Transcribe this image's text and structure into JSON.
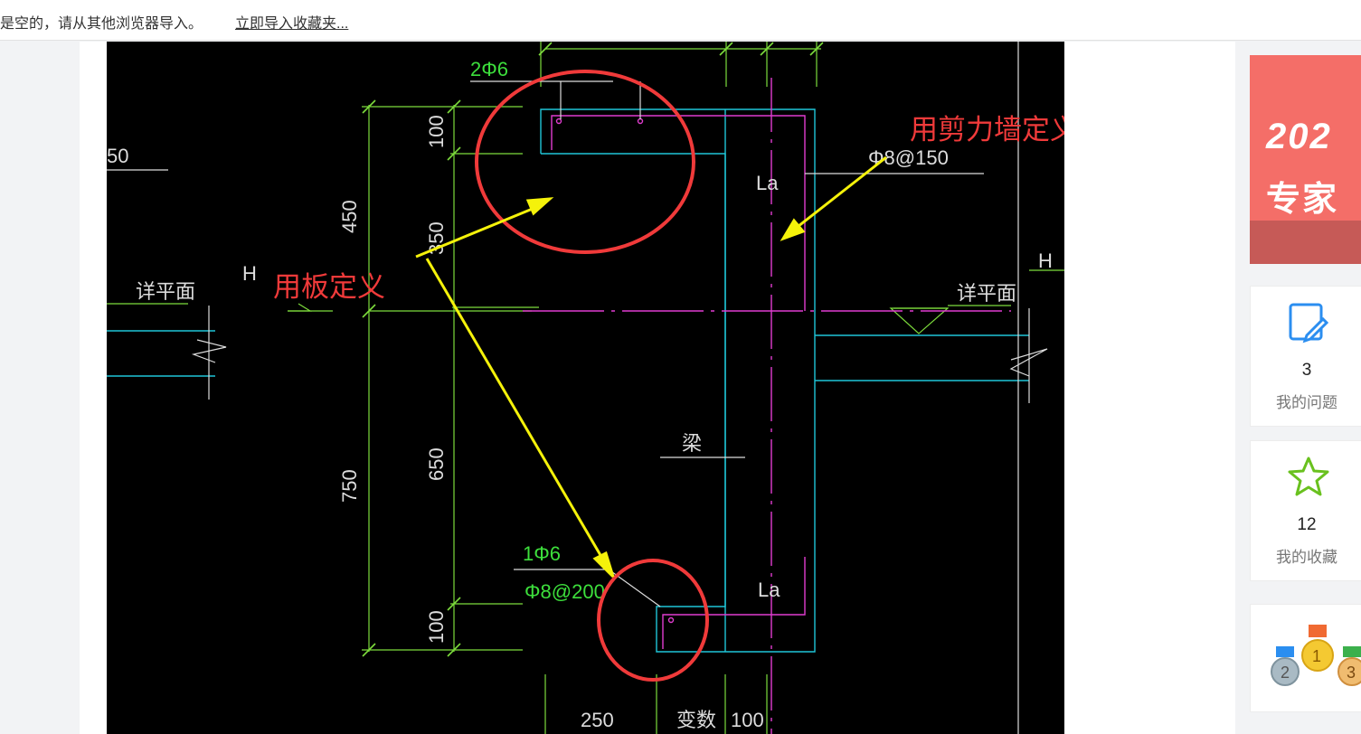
{
  "topbar": {
    "message": "是空的，请从其他浏览器导入。",
    "import_link": "立即导入收藏夹..."
  },
  "drawing": {
    "dim_top_rebar": "2Φ6",
    "dim_100_top": "100",
    "dim_450": "450",
    "dim_350": "350",
    "dim_650": "650",
    "dim_750": "750",
    "dim_100_bottom": "100",
    "dim_250": "250",
    "dim_var": "变数",
    "dim_100_right": "100",
    "partial_left": "50",
    "label_h_left": "H",
    "label_h_right": "H",
    "detail_left": "详平面",
    "detail_right": "详平面",
    "la_top": "La",
    "la_bottom": "La",
    "stirrup_top": "Φ8@150",
    "bottom_rebar": "1Φ6",
    "stirrup_bottom": "Φ8@200",
    "beam_label": "梁",
    "annotation_slab": "用板定义",
    "annotation_wall": "用剪力墙定义"
  },
  "sidebar": {
    "banner_line1": "202",
    "banner_line2": "专家",
    "questions": {
      "count": "3",
      "label": "我的问题",
      "icon": "edit-icon"
    },
    "favorites": {
      "count": "12",
      "label": "我的收藏",
      "icon": "star-icon"
    },
    "medals": {
      "icon": "medals-icon",
      "first": "1",
      "second": "2",
      "third": "3"
    }
  },
  "colors": {
    "cad_bg": "#000000",
    "dim_green": "#7ddc3c",
    "rebar_magenta": "#e03ccf",
    "outline_cyan": "#1fc6d8",
    "annotation_red": "#f03a3a",
    "arrow_yellow": "#f5f20a",
    "banner": "#f46e68"
  }
}
